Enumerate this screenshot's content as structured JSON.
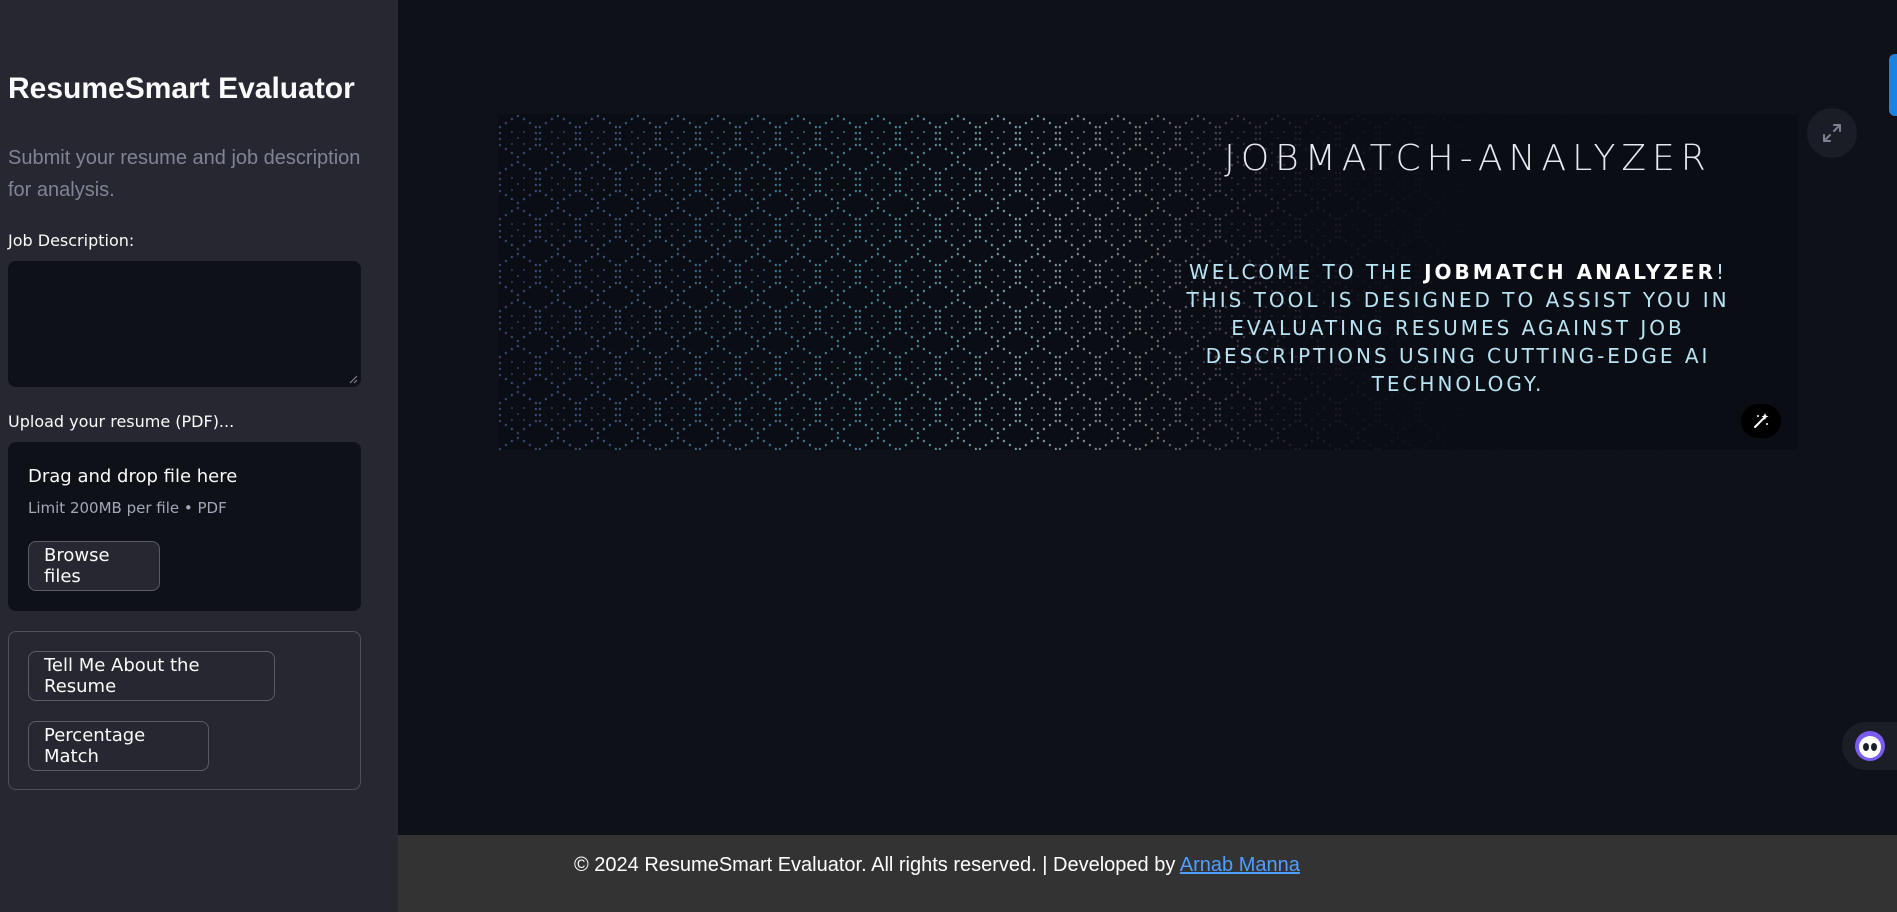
{
  "sidebar": {
    "title": "ResumeSmart Evaluator",
    "subtitle": "Submit your resume and job description for analysis.",
    "job_description_label": "Job Description:",
    "job_description_value": "",
    "upload_label": "Upload your resume (PDF)...",
    "dropzone_title": "Drag and drop file here",
    "dropzone_limit": "Limit 200MB per file • PDF",
    "browse_label": "Browse files",
    "tell_me_label": "Tell Me About the Resume",
    "percentage_match_label": "Percentage Match"
  },
  "banner": {
    "title": "JOBMATCH-ANALYZER",
    "body_prefix": "WELCOME TO THE ",
    "body_bold": "JOBMATCH ANALYZER",
    "body_suffix": "! THIS TOOL IS DESIGNED TO ASSIST YOU IN EVALUATING RESUMES AGAINST JOB DESCRIPTIONS USING CUTTING-EDGE AI TECHNOLOGY."
  },
  "footer": {
    "text": "© 2024 ResumeSmart Evaluator. All rights reserved. | Developed by ",
    "link_text": "Arnab Manna"
  },
  "icons": {
    "expand": "expand-icon",
    "magic": "magic-wand-icon",
    "assistant": "assistant-icon"
  },
  "colors": {
    "background": "#0e1117",
    "sidebar": "#262730",
    "accent": "#1c83e1",
    "link": "#4e9fff",
    "footer": "#333333"
  }
}
